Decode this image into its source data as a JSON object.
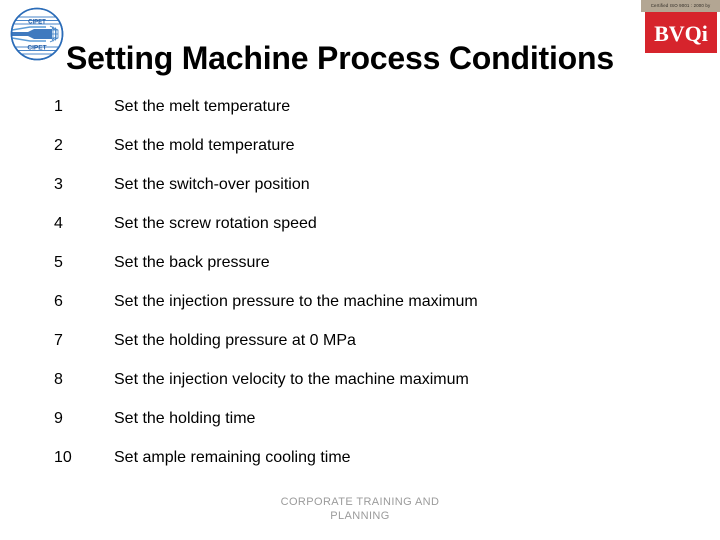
{
  "slide": {
    "title": "Setting Machine Process Conditions",
    "background_color": "#ffffff",
    "title_color": "#000000"
  },
  "logos": {
    "left": {
      "name": "CIPET",
      "top_text": "CIPET",
      "bottom_text": "CIPET",
      "primary_color": "#2b6cb8",
      "secondary_color": "#5b9bd5"
    },
    "right": {
      "certification_text": "Certified ISO 9001 : 2000 by",
      "wordmark": "BVQi",
      "bar_color": "#b3a693",
      "badge_color": "#d6242c",
      "wordmark_color": "#ffffff"
    }
  },
  "steps": [
    {
      "number": "1",
      "text": "Set the melt temperature"
    },
    {
      "number": "2",
      "text": "Set the mold temperature"
    },
    {
      "number": "3",
      "text": "Set the switch-over position"
    },
    {
      "number": "4",
      "text": "Set the screw rotation speed"
    },
    {
      "number": "5",
      "text": "Set the back pressure"
    },
    {
      "number": "6",
      "text": "Set the injection pressure to the machine maximum"
    },
    {
      "number": "7",
      "text": "Set the holding pressure at 0 MPa"
    },
    {
      "number": "8",
      "text": "Set the injection velocity to the machine maximum"
    },
    {
      "number": "9",
      "text": "Set the holding time"
    },
    {
      "number": "10",
      "text": "Set ample remaining cooling time"
    }
  ],
  "footer": {
    "line1": "CORPORATE TRAINING AND",
    "line2": "PLANNING",
    "color": "#9b9b9b"
  }
}
